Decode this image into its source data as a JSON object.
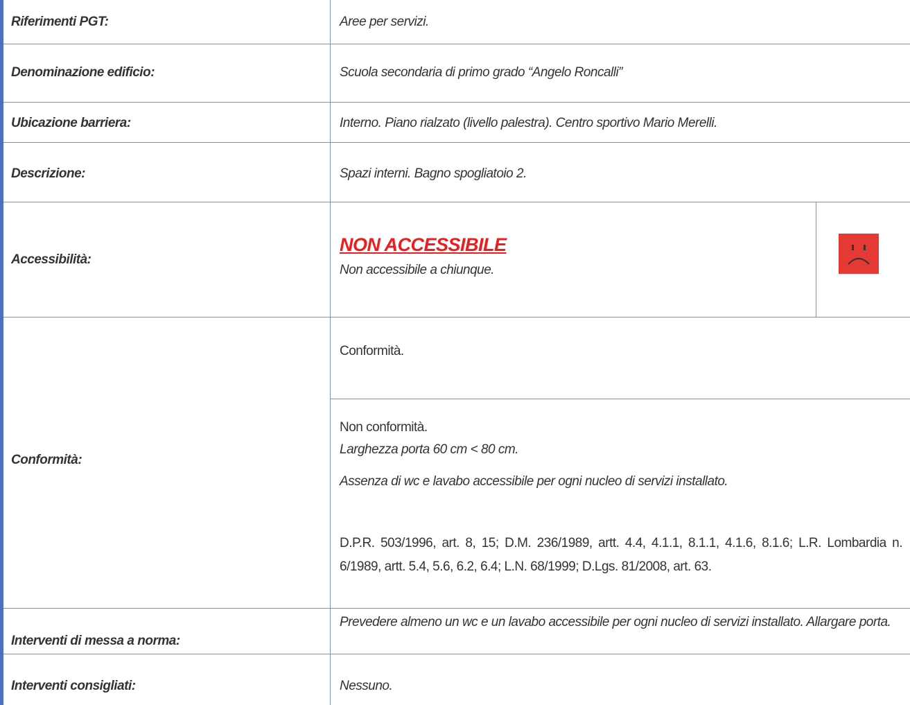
{
  "rows": {
    "riferimenti": {
      "label": "Riferimenti PGT:",
      "value": "Aree per servizi."
    },
    "denominazione": {
      "label": "Denominazione edificio:",
      "value": "Scuola secondaria di primo grado “Angelo Roncalli”"
    },
    "ubicazione": {
      "label": "Ubicazione barriera:",
      "value": "Interno. Piano rialzato (livello palestra). Centro sportivo Mario Merelli."
    },
    "descrizione": {
      "label": "Descrizione:",
      "value": "Spazi interni. Bagno spogliatoio 2."
    },
    "accessibilita": {
      "label": "Accessibilità:",
      "status": "NON ACCESSIBILE",
      "note": "Non accessibile a chiunque.",
      "status_color": "#ee1c1c",
      "icon": "sad-face-icon"
    },
    "conformita": {
      "label": "Conformità:",
      "conf_title": "Conformità.",
      "nonconf_title": "Non conformità.",
      "items": [
        "Larghezza porta 60 cm < 80 cm.",
        "Assenza di wc e lavabo accessibile per ogni nucleo di servizi installato."
      ],
      "references": "D.P.R. 503/1996, art. 8, 15; D.M. 236/1989, artt. 4.4, 4.1.1, 8.1.1, 4.1.6, 8.1.6; L.R. Lombardia n. 6/1989, artt. 5.4, 5.6, 6.2, 6.4; L.N. 68/1999; D.Lgs. 81/2008, art. 63."
    },
    "interventi_norma": {
      "label": "Interventi di messa a norma:",
      "value": "Prevedere almeno un wc e un lavabo accessibile per ogni nucleo di servizi installato. Allargare porta."
    },
    "interventi_consigliati": {
      "label": "Interventi consigliati:",
      "value": "Nessuno."
    }
  }
}
